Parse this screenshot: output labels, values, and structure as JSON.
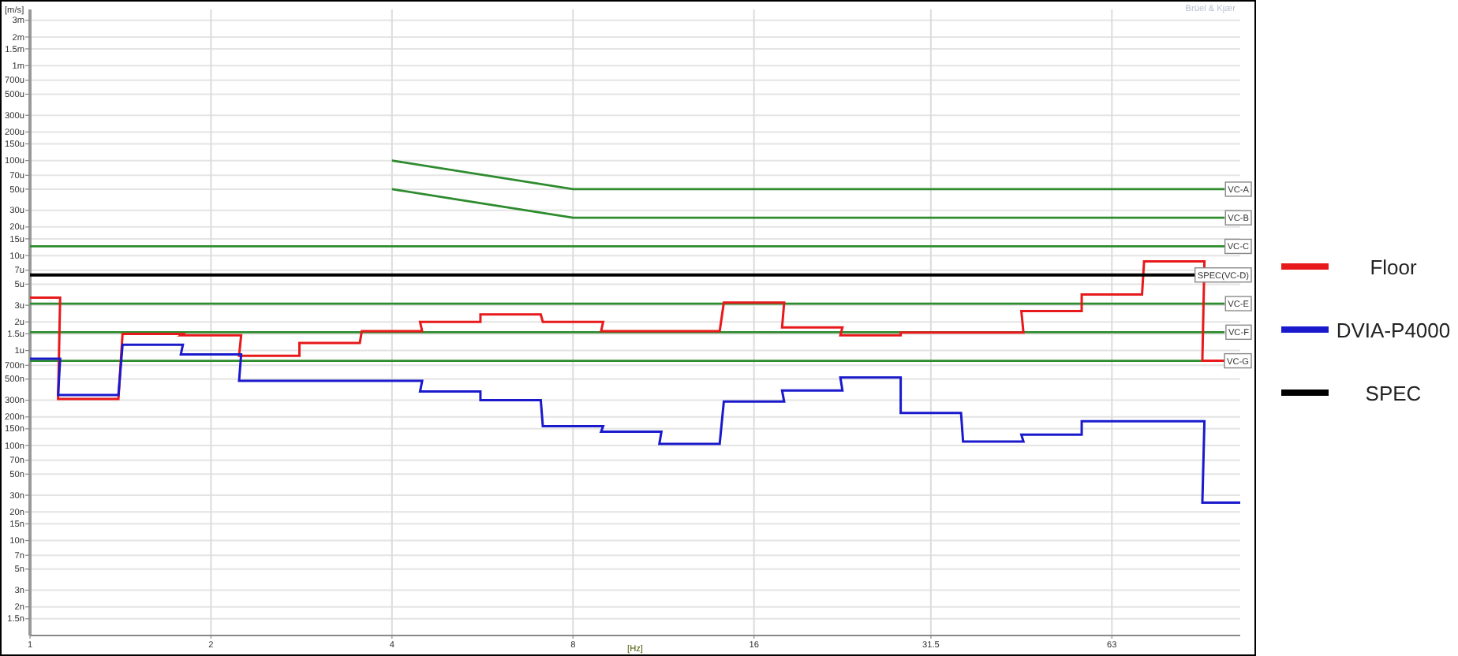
{
  "chart": {
    "brand": "Brüel & Kjær",
    "y_unit": "[m/s]",
    "x_unit": "[Hz]",
    "y_axis_labels": [
      "3m",
      "2m",
      "1.5m",
      "1m",
      "700u",
      "500u",
      "300u",
      "200u",
      "150u",
      "100u",
      "70u",
      "50u",
      "30u",
      "20u",
      "15u",
      "10u",
      "7u",
      "5u",
      "3u",
      "2u",
      "1.5u",
      "1u",
      "700n",
      "500n",
      "300n",
      "200n",
      "150n",
      "100n",
      "70n",
      "50n",
      "30n",
      "20n",
      "15n",
      "10n",
      "7n",
      "5n",
      "3n",
      "2n",
      "1.5n"
    ],
    "x_axis_labels": [
      "1",
      "2",
      "4",
      "8",
      "16",
      "31.5",
      "63"
    ],
    "line_tags": [
      "VC-A",
      "VC-B",
      "VC-C",
      "SPEC(VC-D)",
      "VC-E",
      "VC-F",
      "VC-G"
    ]
  },
  "legend": [
    {
      "label": "Floor",
      "color": "#e8191b"
    },
    {
      "label": "DVIA-P4000",
      "color": "#1a1acc"
    },
    {
      "label": "SPEC",
      "color": "#000000"
    }
  ]
}
